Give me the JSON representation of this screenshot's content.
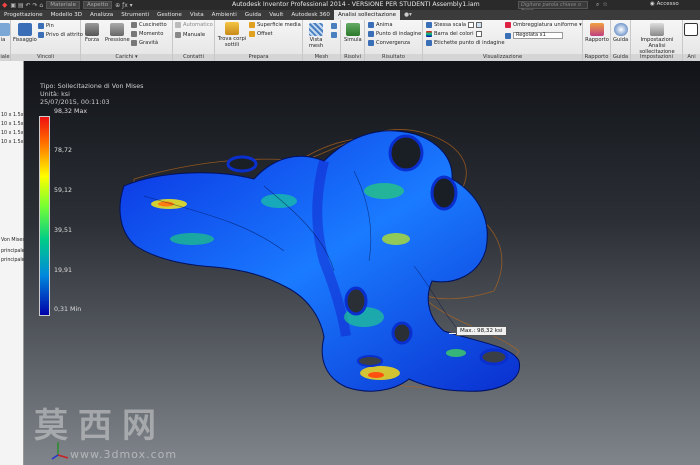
{
  "titlebar": {
    "material": "Materiale",
    "appearance": "Aspetto",
    "title": "Autodesk Inventor Professional 2014 - VERSIONE PER STUDENTI     Assembly1.iam",
    "search_placeholder": "Digitare parola chiave o frase",
    "access": "Accesso"
  },
  "tabs": [
    {
      "label": "Progettazione"
    },
    {
      "label": "Modello 3D"
    },
    {
      "label": "Analizza"
    },
    {
      "label": "Strumenti"
    },
    {
      "label": "Gestione"
    },
    {
      "label": "Vista"
    },
    {
      "label": "Ambienti"
    },
    {
      "label": "Guida"
    },
    {
      "label": "Vault"
    },
    {
      "label": "Autodesk 360"
    },
    {
      "label": "Analisi sollecitazione"
    }
  ],
  "ribbon": {
    "panels": {
      "materiale": "iale",
      "vincoli": "Vincoli",
      "carichi": "Carichi ▾",
      "contatti": "Contatti",
      "prepara": "Prepara",
      "mesh": "Mesh",
      "risolvi": "Risolvi",
      "risultato": "Risultato",
      "visualizzazione": "Visualizzazione",
      "rapporto": "Rapporto",
      "guida": "Guida",
      "impostazioni": "Impostazioni",
      "end": "Ani"
    },
    "fissaggio": "Fissaggio",
    "pin": "Pin",
    "privo_attrito": "Privo di attrito",
    "forza": "Forza",
    "pressione": "Pressione",
    "cuscinetto": "Cuscinetto",
    "momento": "Momento",
    "gravita": "Gravità",
    "automatico": "Automatico",
    "manuale": "Manuale",
    "trova_corpi": "Trova corpi sottili",
    "superficie_media": "Superficie media",
    "offset": "Offset",
    "vista_mesh": "Vista mesh",
    "simula": "Simula",
    "anima": "Anima",
    "punto_indagine": "Punto di indagine",
    "convergenza": "Convergenza",
    "stessa_scala": "Stessa scala",
    "barra_colori": "Barra dei colori",
    "etichette": "Etichette punto di indagine",
    "ombreggiatura": "Ombreggiatura uniforme ▾",
    "scale_value": "Regolata x1",
    "rapporto": "Rapporto",
    "guida": "Guida",
    "impostazioni": "Impostazioni Analisi sollecitazione",
    "edge": "ia"
  },
  "browser": {
    "rows": [
      "10 x 1.5x16:1",
      "10 x 1.5x16:1",
      "10 x 1.5x16:1",
      "10 x 1.5x16:1",
      "Von Mises",
      "principale",
      "principale"
    ]
  },
  "viewport": {
    "result_type": "Tipo: Sollecitazione di Von Mises",
    "unit": "Unità: ksi",
    "datetime": "25/07/2015, 00:11:03",
    "tooltip": "Max.: 98,32 ksi",
    "legend": {
      "max": "98,32 Max",
      "v1": "78,72",
      "v2": "59,12",
      "v3": "39,51",
      "v4": "19,91",
      "min": "0,31 Min"
    }
  },
  "watermark": {
    "logo": "莫西网",
    "url": "www.3dmox.com"
  },
  "colors": {
    "accent_tab": "#e9e9e9",
    "ribbon_bg": "#f0f0f0",
    "legend_top": "#e11",
    "legend_bottom": "#00a"
  }
}
